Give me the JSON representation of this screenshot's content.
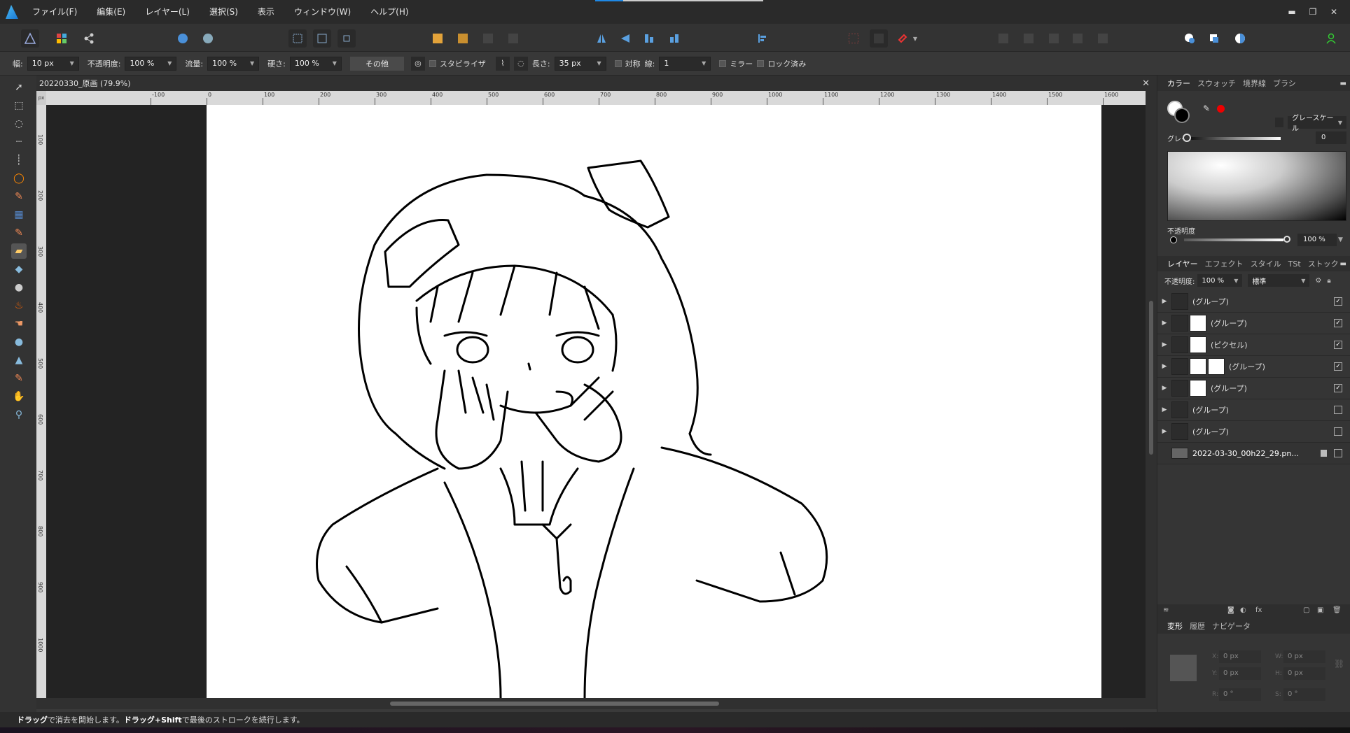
{
  "menu": {
    "items": [
      "ファイル(F)",
      "編集(E)",
      "レイヤー(L)",
      "選択(S)",
      "表示",
      "ウィンドウ(W)",
      "ヘルプ(H)"
    ]
  },
  "window_controls": {
    "minimize": "▬",
    "restore": "❐",
    "close": "✕"
  },
  "context": {
    "width_label": "幅:",
    "width_value": "10 px",
    "opacity_label": "不透明度:",
    "opacity_value": "100 %",
    "flow_label": "流量:",
    "flow_value": "100 %",
    "hardness_label": "硬さ:",
    "hardness_value": "100 %",
    "more_button": "その他",
    "stabilizer_label": "スタビライザ",
    "length_label": "長さ:",
    "length_value": "35 px",
    "symmetry_label": "対称",
    "lines_label": "線:",
    "lines_value": "1",
    "mirror_label": "ミラー",
    "locked_label": "ロック済み"
  },
  "document": {
    "tab_title": "20220330_原画 (79.9%)",
    "close": "✕"
  },
  "ruler": {
    "unit": "px",
    "h_ticks": [
      "-100",
      "0",
      "100",
      "200",
      "300",
      "400",
      "500",
      "600",
      "700",
      "800",
      "900",
      "1000",
      "1100",
      "1200",
      "1300",
      "1400",
      "1500",
      "1600"
    ],
    "v_ticks": [
      "100",
      "200",
      "300",
      "400",
      "500",
      "600",
      "700",
      "800",
      "900",
      "1000"
    ]
  },
  "colour_panel": {
    "tabs": [
      "カラー",
      "スウォッチ",
      "境界線",
      "ブラシ"
    ],
    "mode": "グレースケール",
    "grey_label": "グレー",
    "grey_value": "0",
    "opacity_label": "不透明度",
    "opacity_value": "100 %",
    "accent_red": "#e00000"
  },
  "layers_panel": {
    "tabs": [
      "レイヤー",
      "エフェクト",
      "スタイル",
      "TSt",
      "ストック"
    ],
    "opacity_label": "不透明度:",
    "opacity_value": "100 %",
    "blend_mode": "標準",
    "layers": [
      {
        "name": "(グループ)",
        "checked": "✓"
      },
      {
        "name": "(グループ)",
        "checked": "✓"
      },
      {
        "name": "(ピクセル)",
        "checked": "✓"
      },
      {
        "name": "(グループ)",
        "checked": "✓"
      },
      {
        "name": "(グループ)",
        "checked": "✓"
      },
      {
        "name": "(グループ)",
        "checked": ""
      },
      {
        "name": "(グループ)",
        "checked": ""
      },
      {
        "name": "2022-03-30_00h22_29.pn...",
        "checked": ""
      }
    ]
  },
  "transform_panel": {
    "tabs": [
      "変形",
      "履歴",
      "ナビゲータ"
    ],
    "x_value": "0 px",
    "y_value": "0 px",
    "w_value": "0 px",
    "h_value": "0 px",
    "r_value": "0 °",
    "s_value": "0 °",
    "x_label": "X:",
    "y_label": "Y:",
    "w_label": "W:",
    "h_label": "H:",
    "r_label": "R:",
    "s_label": "S:"
  },
  "status": {
    "drag": "ドラッグ",
    "text1": "で消去を開始します。",
    "drag_shift": "ドラッグ+Shift",
    "text2": "で最後のストロークを続行します。"
  }
}
